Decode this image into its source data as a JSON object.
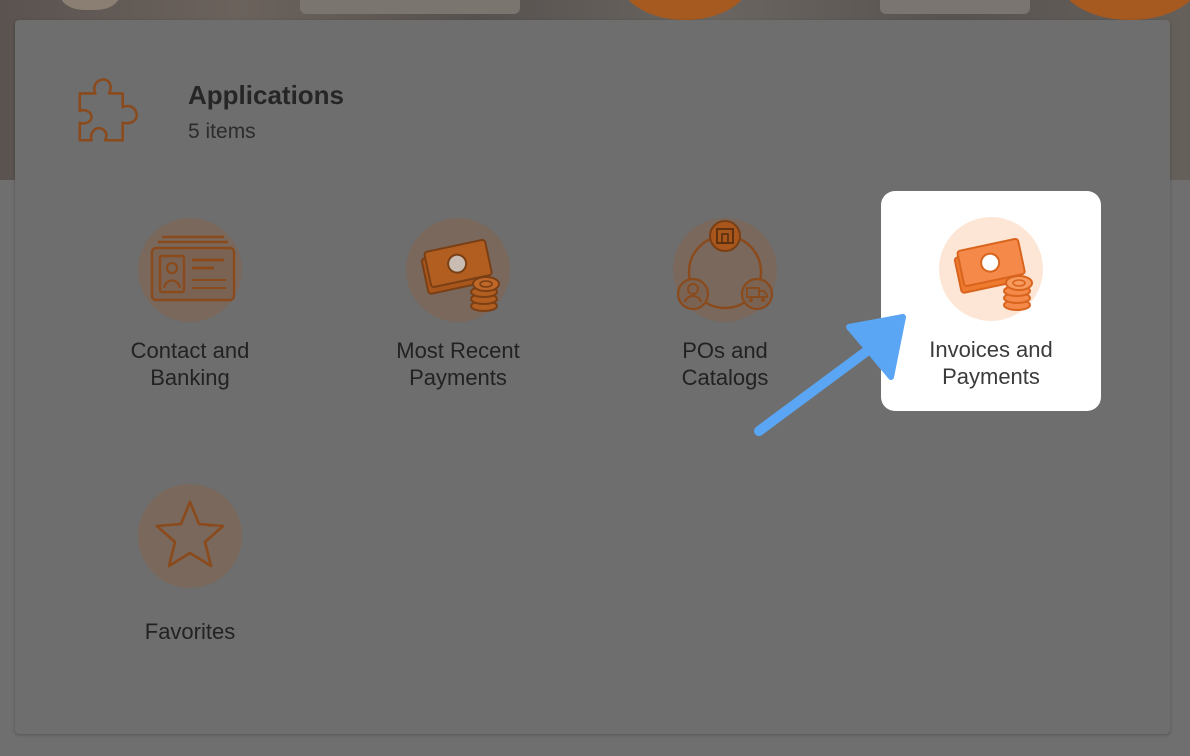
{
  "header": {
    "title": "Applications",
    "count": "5 items",
    "icon": "puzzle-piece-icon"
  },
  "apps": [
    {
      "label_line1": "Contact and",
      "label_line2": "Banking",
      "icon": "id-card-icon"
    },
    {
      "label_line1": "Most Recent",
      "label_line2": "Payments",
      "icon": "cash-coins-icon"
    },
    {
      "label_line1": "POs and",
      "label_line2": "Catalogs",
      "icon": "network-store-icon"
    },
    {
      "label_line1": "Invoices and",
      "label_line2": "Payments",
      "icon": "cash-coins-icon",
      "highlighted": true
    },
    {
      "label_line1": "Favorites",
      "label_line2": "",
      "icon": "star-icon"
    }
  ],
  "colors": {
    "accent": "#ef7a2f",
    "accent_dim": "#8a4a1c",
    "callout_arrow": "#5aa6f5",
    "overlay": "#6e6e6e",
    "highlight_bg": "#ffffff"
  }
}
